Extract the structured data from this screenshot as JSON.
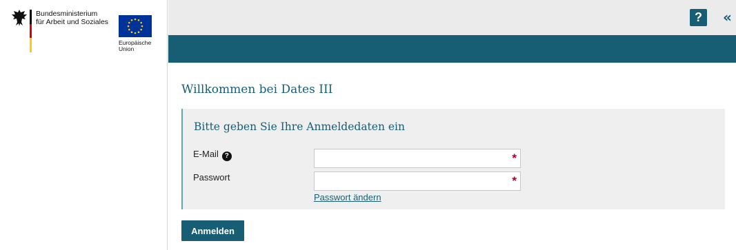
{
  "sidebar": {
    "ministry_line1": "Bundesministerium",
    "ministry_line2": "für Arbeit und Soziales",
    "eu_line1": "Europäische",
    "eu_line2": "Union"
  },
  "header": {
    "help_label": "?",
    "collapse_label": "«",
    "help_icon": "question-icon",
    "collapse_icon": "double-chevron-left-icon"
  },
  "main": {
    "welcome_title": "Willkommen bei Dates III",
    "login_panel": {
      "title": "Bitte geben Sie Ihre Anmeldedaten ein",
      "email": {
        "label": "E-Mail",
        "value": "",
        "placeholder": "",
        "info_icon": "info-icon"
      },
      "password": {
        "label": "Passwort",
        "value": "",
        "placeholder": ""
      },
      "required_marker": "*",
      "change_password_link": "Passwort ändern"
    },
    "login_button": "Anmelden"
  },
  "colors": {
    "accent": "#175e74",
    "topbar_bg": "#ebebeb",
    "panel_bg": "#efefef",
    "required": "#b0002a"
  }
}
